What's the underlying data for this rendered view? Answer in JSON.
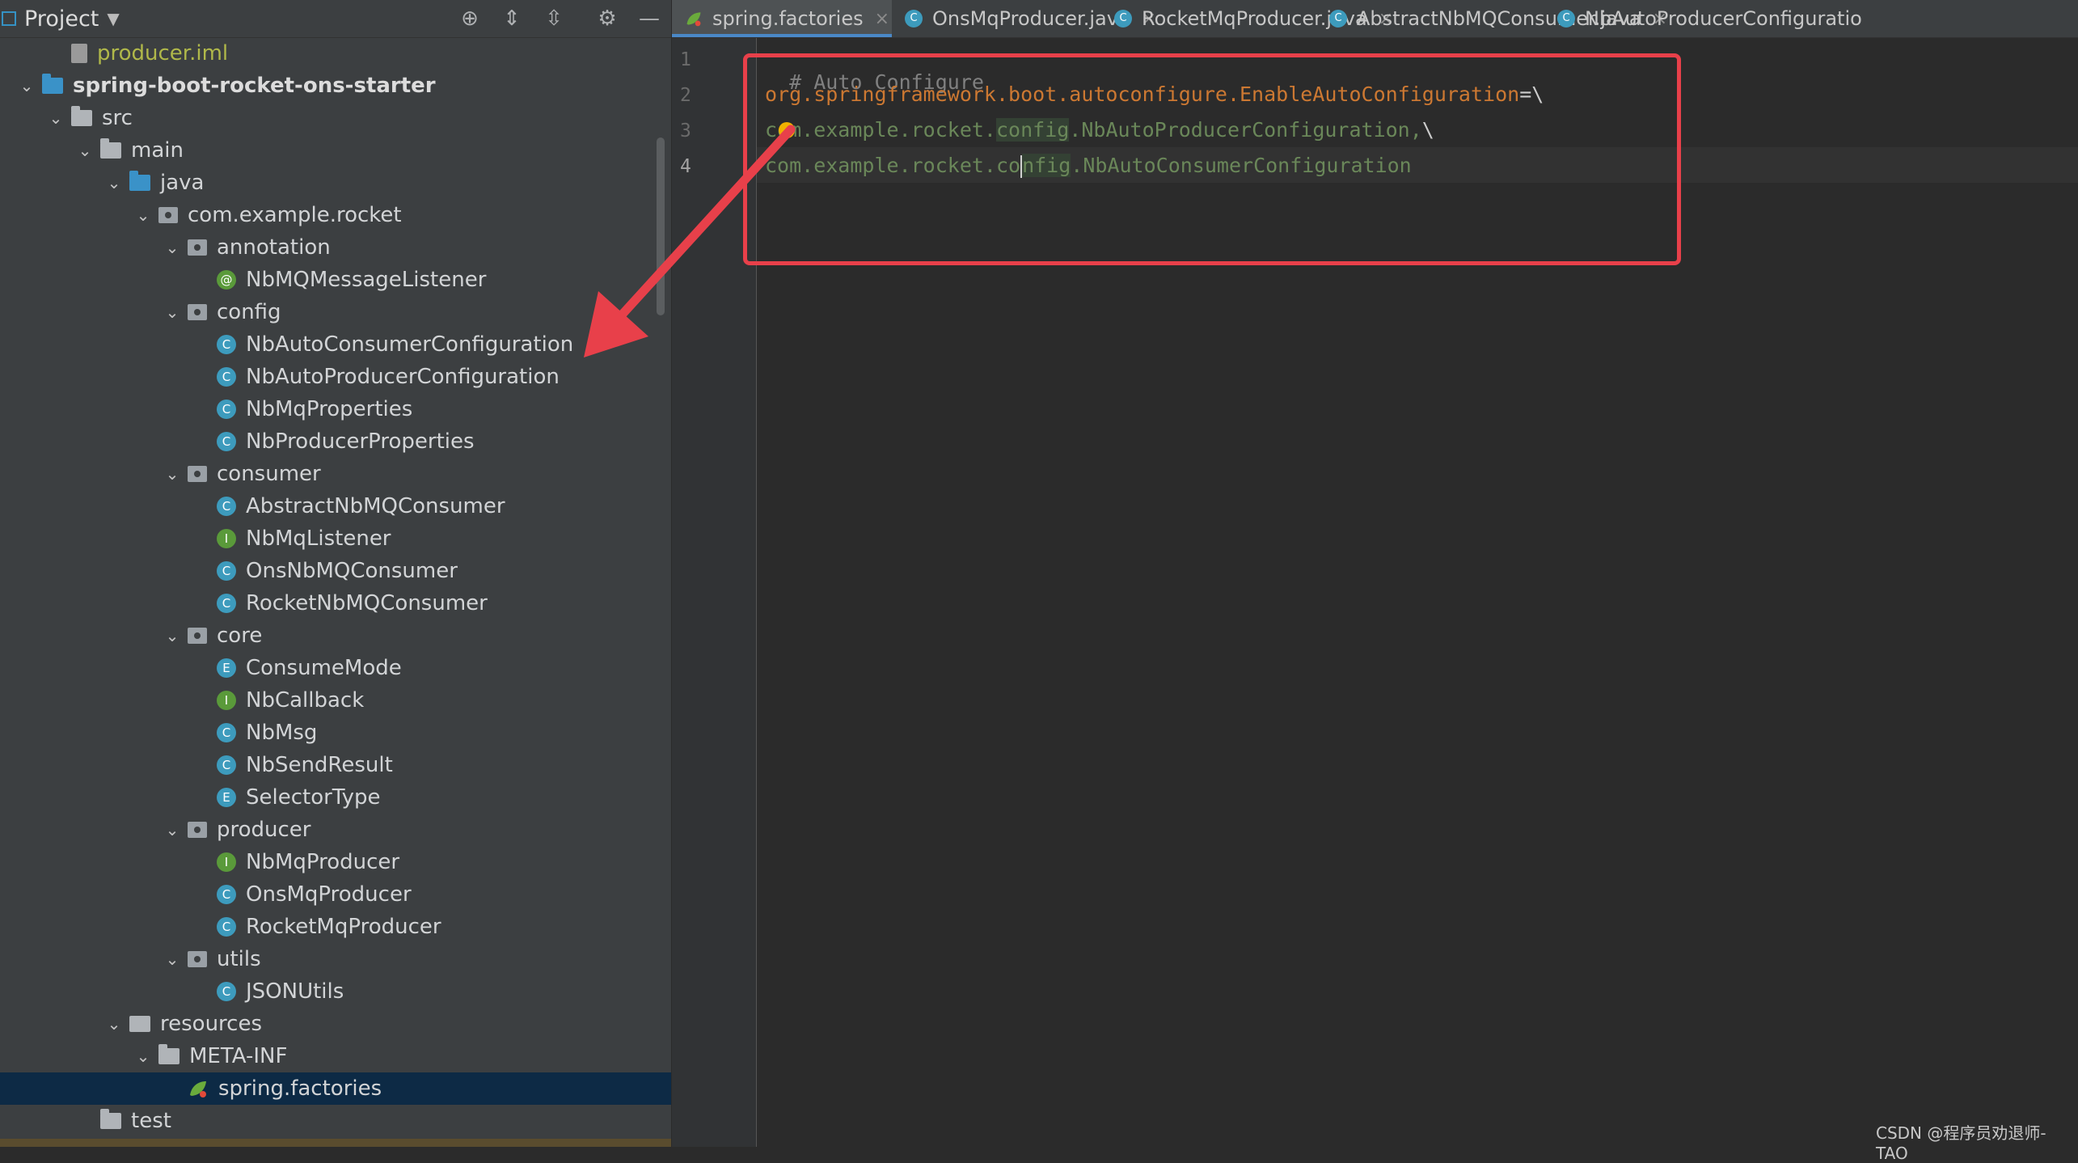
{
  "project_panel": {
    "title": "Project"
  },
  "tree": [
    {
      "label": "producer.iml",
      "indent": 2,
      "icon": "iml-file-icon",
      "style": "green",
      "arrow": ""
    },
    {
      "label": "spring-boot-rocket-ons-starter",
      "indent": 1,
      "icon": "module-folder-icon",
      "style": "bold",
      "arrow": "expanded"
    },
    {
      "label": "src",
      "indent": 2,
      "icon": "folder-icon",
      "style": "",
      "arrow": "expanded"
    },
    {
      "label": "main",
      "indent": 3,
      "icon": "folder-icon",
      "style": "",
      "arrow": "expanded"
    },
    {
      "label": "java",
      "indent": 4,
      "icon": "source-folder-icon",
      "style": "",
      "arrow": "expanded"
    },
    {
      "label": "com.example.rocket",
      "indent": 5,
      "icon": "package-icon",
      "style": "",
      "arrow": "expanded"
    },
    {
      "label": "annotation",
      "indent": 6,
      "icon": "package-icon",
      "style": "",
      "arrow": "expanded"
    },
    {
      "label": "NbMQMessageListener",
      "indent": 7,
      "icon": "annotation-icon",
      "style": "",
      "arrow": ""
    },
    {
      "label": "config",
      "indent": 6,
      "icon": "package-icon",
      "style": "",
      "arrow": "expanded"
    },
    {
      "label": "NbAutoConsumerConfiguration",
      "indent": 7,
      "icon": "class-icon",
      "style": "",
      "arrow": ""
    },
    {
      "label": "NbAutoProducerConfiguration",
      "indent": 7,
      "icon": "class-icon",
      "style": "",
      "arrow": ""
    },
    {
      "label": "NbMqProperties",
      "indent": 7,
      "icon": "class-icon",
      "style": "",
      "arrow": ""
    },
    {
      "label": "NbProducerProperties",
      "indent": 7,
      "icon": "class-icon",
      "style": "",
      "arrow": ""
    },
    {
      "label": "consumer",
      "indent": 6,
      "icon": "package-icon",
      "style": "",
      "arrow": "expanded"
    },
    {
      "label": "AbstractNbMQConsumer",
      "indent": 7,
      "icon": "abstract-class-icon",
      "style": "",
      "arrow": ""
    },
    {
      "label": "NbMqListener",
      "indent": 7,
      "icon": "interface-icon",
      "style": "",
      "arrow": ""
    },
    {
      "label": "OnsNbMQConsumer",
      "indent": 7,
      "icon": "class-icon",
      "style": "",
      "arrow": ""
    },
    {
      "label": "RocketNbMQConsumer",
      "indent": 7,
      "icon": "class-icon",
      "style": "",
      "arrow": ""
    },
    {
      "label": "core",
      "indent": 6,
      "icon": "package-icon",
      "style": "",
      "arrow": "expanded"
    },
    {
      "label": "ConsumeMode",
      "indent": 7,
      "icon": "enum-icon",
      "style": "",
      "arrow": ""
    },
    {
      "label": "NbCallback",
      "indent": 7,
      "icon": "interface-icon",
      "style": "",
      "arrow": ""
    },
    {
      "label": "NbMsg",
      "indent": 7,
      "icon": "class-icon",
      "style": "",
      "arrow": ""
    },
    {
      "label": "NbSendResult",
      "indent": 7,
      "icon": "class-icon",
      "style": "",
      "arrow": ""
    },
    {
      "label": "SelectorType",
      "indent": 7,
      "icon": "enum-icon",
      "style": "",
      "arrow": ""
    },
    {
      "label": "producer",
      "indent": 6,
      "icon": "package-icon",
      "style": "",
      "arrow": "expanded"
    },
    {
      "label": "NbMqProducer",
      "indent": 7,
      "icon": "interface-icon",
      "style": "",
      "arrow": ""
    },
    {
      "label": "OnsMqProducer",
      "indent": 7,
      "icon": "class-icon",
      "style": "",
      "arrow": ""
    },
    {
      "label": "RocketMqProducer",
      "indent": 7,
      "icon": "class-icon",
      "style": "",
      "arrow": ""
    },
    {
      "label": "utils",
      "indent": 6,
      "icon": "package-icon",
      "style": "",
      "arrow": "expanded"
    },
    {
      "label": "JSONUtils",
      "indent": 7,
      "icon": "class-icon",
      "style": "",
      "arrow": ""
    },
    {
      "label": "resources",
      "indent": 4,
      "icon": "resources-folder-icon",
      "style": "",
      "arrow": "expanded"
    },
    {
      "label": "META-INF",
      "indent": 5,
      "icon": "folder-icon",
      "style": "",
      "arrow": "expanded"
    },
    {
      "label": "spring.factories",
      "indent": 6,
      "icon": "spring-icon",
      "style": "",
      "arrow": "",
      "selected": true
    },
    {
      "label": "test",
      "indent": 3,
      "icon": "folder-icon",
      "style": "",
      "arrow": ""
    }
  ],
  "tabs": [
    {
      "label": "spring.factories",
      "icon": "spring-icon",
      "active": true
    },
    {
      "label": "OnsMqProducer.java",
      "icon": "class-icon",
      "active": false
    },
    {
      "label": "RocketMqProducer.java",
      "icon": "class-icon",
      "active": false
    },
    {
      "label": "AbstractNbMQConsumer.java",
      "icon": "abstract-class-icon",
      "active": false
    },
    {
      "label": "NbAutoProducerConfiguratio",
      "icon": "class-icon",
      "active": false
    }
  ],
  "editor": {
    "line_numbers": [
      "1",
      "2",
      "3",
      "4"
    ],
    "current_line": "4",
    "line1": "# Auto Configure",
    "line2_key": "org.springframework.boot.autoconfigure.EnableAutoConfiguration",
    "line2_op": "=\\",
    "line3_a": "com.example.rocket.",
    "line3_b": "config",
    "line3_c": ".NbAutoProducerConfiguration,",
    "line3_d": "\\",
    "line4_a": "com.example.rocket.co",
    "line4_b": "nfig",
    "line4_c": ".NbAutoConsumerConfiguration"
  },
  "watermark": "CSDN @程序员劝退师-TAO",
  "colors": {
    "highlight": "#e8404a",
    "accent": "#4a88c7"
  }
}
